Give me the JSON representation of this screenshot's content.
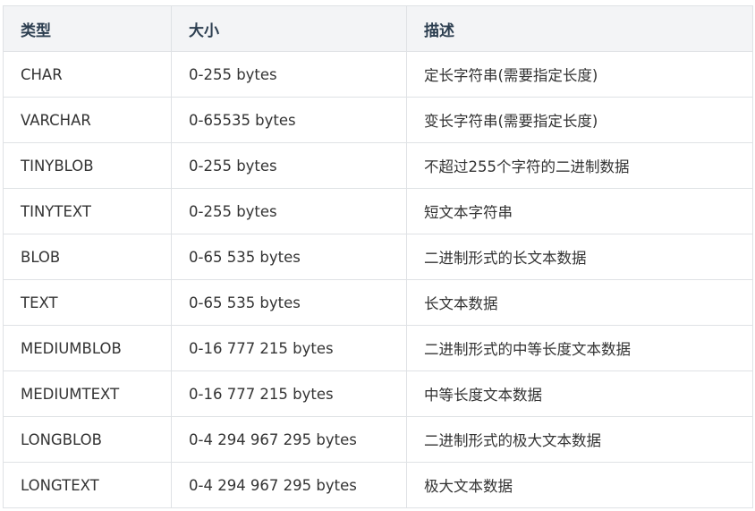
{
  "table": {
    "headers": [
      "类型",
      "大小",
      "描述"
    ],
    "rows": [
      {
        "type": "CHAR",
        "size": "0-255 bytes",
        "desc": "定长字符串(需要指定长度)"
      },
      {
        "type": "VARCHAR",
        "size": "0-65535 bytes",
        "desc": "变长字符串(需要指定长度)"
      },
      {
        "type": "TINYBLOB",
        "size": "0-255 bytes",
        "desc": "不超过255个字符的二进制数据"
      },
      {
        "type": "TINYTEXT",
        "size": "0-255 bytes",
        "desc": "短文本字符串"
      },
      {
        "type": "BLOB",
        "size": "0-65 535 bytes",
        "desc": "二进制形式的长文本数据"
      },
      {
        "type": "TEXT",
        "size": "0-65 535 bytes",
        "desc": "长文本数据"
      },
      {
        "type": "MEDIUMBLOB",
        "size": "0-16 777 215 bytes",
        "desc": "二进制形式的中等长度文本数据"
      },
      {
        "type": "MEDIUMTEXT",
        "size": "0-16 777 215 bytes",
        "desc": "中等长度文本数据"
      },
      {
        "type": "LONGBLOB",
        "size": "0-4 294 967 295 bytes",
        "desc": "二进制形式的极大文本数据"
      },
      {
        "type": "LONGTEXT",
        "size": "0-4 294 967 295 bytes",
        "desc": "极大文本数据"
      }
    ]
  },
  "colors": {
    "header_background": "#f3f4f6",
    "border": "#dfe2e5",
    "header_text": "#2c3e50",
    "body_text": "#333333"
  }
}
